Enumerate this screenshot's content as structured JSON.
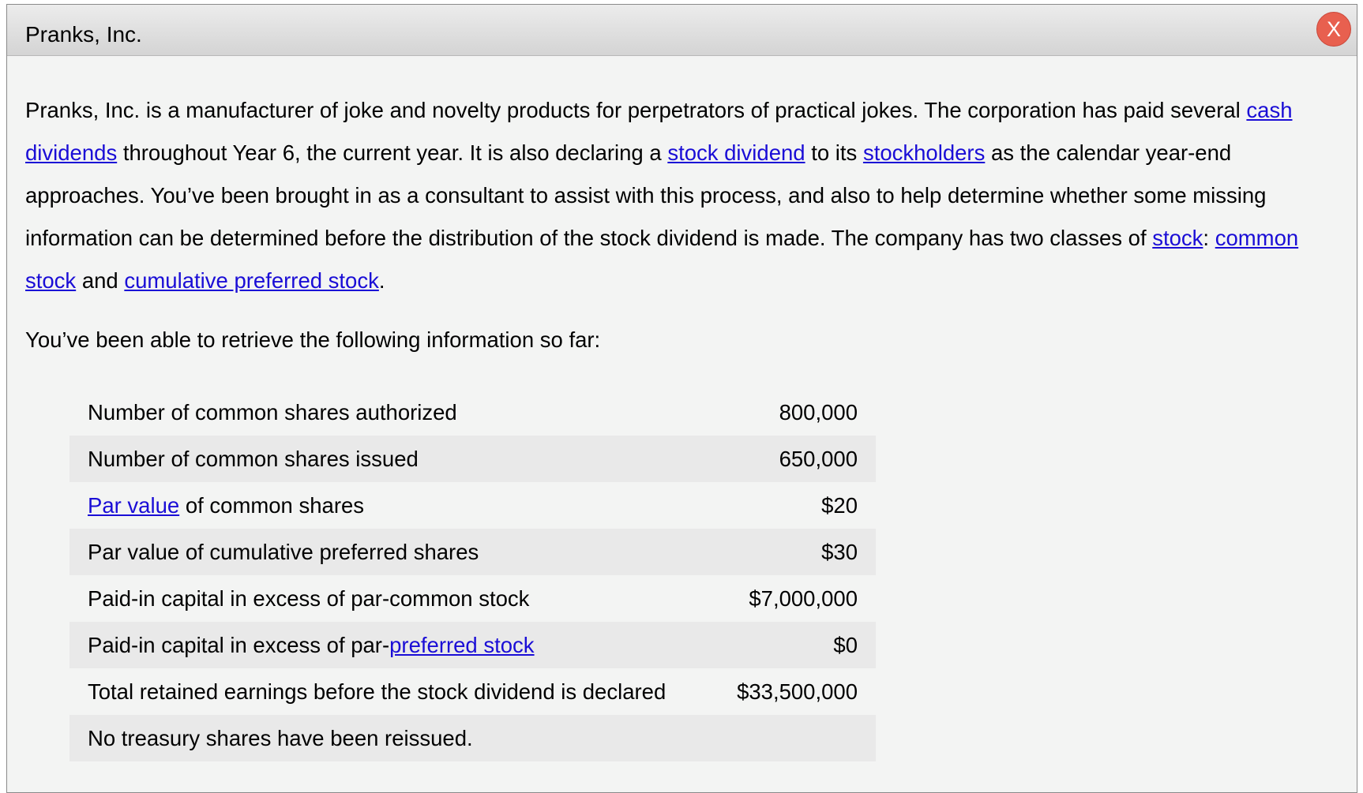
{
  "dialog": {
    "title": "Pranks, Inc.",
    "close_label": "X"
  },
  "intro": {
    "t1": "Pranks, Inc. is a manufacturer of joke and novelty products for perpetrators of practical jokes. The corporation has paid several ",
    "link_cash_dividends": "cash dividends",
    "t2": " throughout Year 6, the current year. It is also declaring a ",
    "link_stock_dividend": "stock dividend",
    "t3": " to its ",
    "link_stockholders": "stockholders",
    "t4": " as the calendar year-end approaches. You’ve been brought in as a consultant to assist with this process, and also to help determine whether some missing information can be determined before the distribution of the stock dividend is made. The company has two classes of ",
    "link_stock": "stock",
    "t5": ": ",
    "link_common_stock": "common stock",
    "t6": " and ",
    "link_cumulative_preferred_stock": "cumulative preferred stock",
    "t7": "."
  },
  "retrieve_text": "You’ve been able to retrieve the following information so far:",
  "table": {
    "row1": {
      "label": "Number of common shares authorized",
      "value": "800,000"
    },
    "row2": {
      "label": "Number of common shares issued",
      "value": "650,000"
    },
    "row3": {
      "link": "Par value",
      "label_rest": " of common shares",
      "value": "$20"
    },
    "row4": {
      "label": "Par value of cumulative preferred shares",
      "value": "$30"
    },
    "row5": {
      "label": "Paid-in capital in excess of par-common stock",
      "value": "$7,000,000"
    },
    "row6": {
      "label_prefix": "Paid-in capital in excess of par-",
      "link": "preferred stock",
      "value": "$0"
    },
    "row7": {
      "label": "Total retained earnings before the stock dividend is declared",
      "value": "$33,500,000"
    },
    "row8": {
      "label": "No treasury shares have been reissued."
    }
  },
  "colors": {
    "link": "#1a0dd6",
    "close_button": "#e8604f",
    "stripe": "#e9e9e9",
    "panel": "#f3f4f3"
  }
}
